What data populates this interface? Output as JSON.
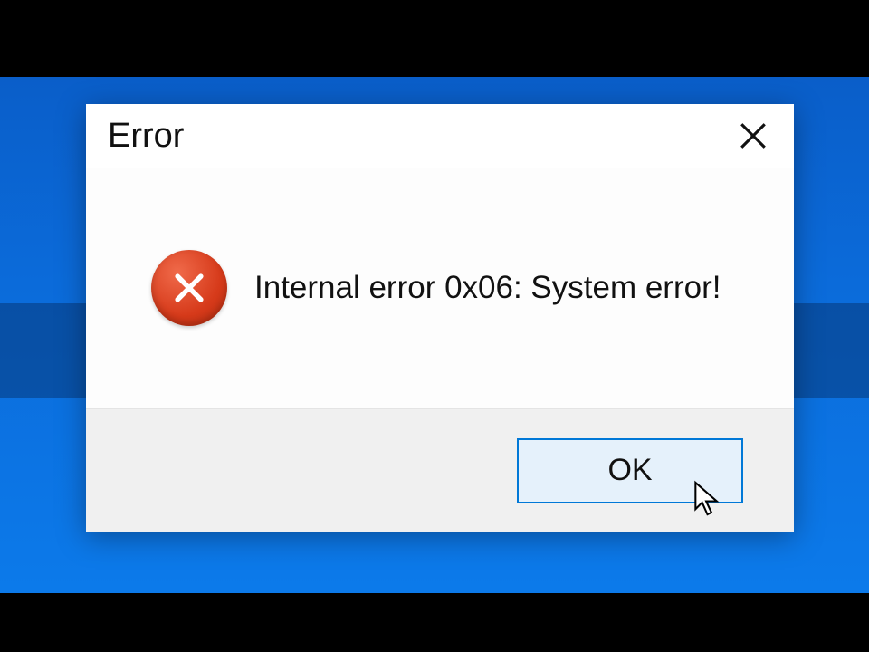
{
  "dialog": {
    "title": "Error",
    "message": "Internal error 0x06: System error!",
    "ok_label": "OK"
  },
  "icons": {
    "close": "close-icon",
    "error": "error-x-icon",
    "cursor": "cursor-pointer"
  },
  "colors": {
    "desktop_blue": "#0b6bda",
    "button_border": "#0078d7",
    "button_bg": "#e5f1fb",
    "footer_bg": "#f0f0f0",
    "error_red": "#d63a1a"
  }
}
